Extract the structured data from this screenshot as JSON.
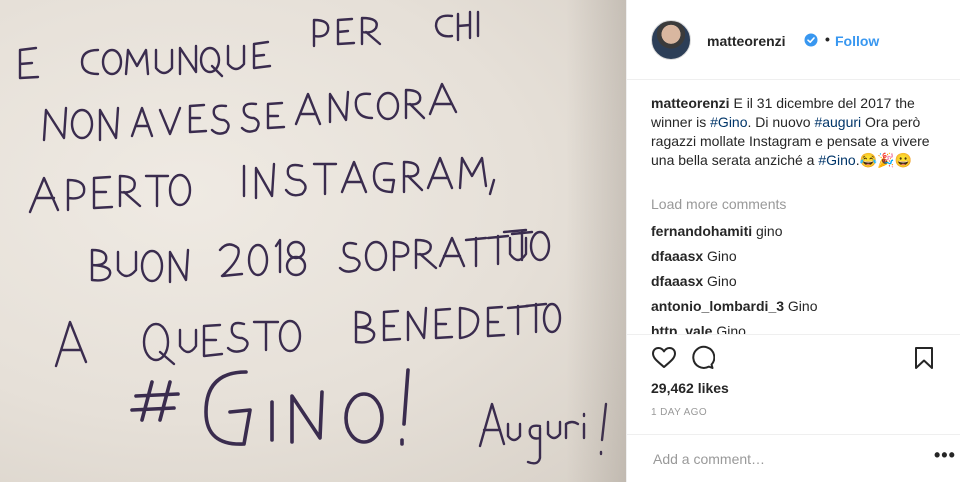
{
  "colors": {
    "link_blue": "#3897f0",
    "hashtag": "#003569",
    "muted": "#999999",
    "text": "#262626",
    "ink": "#3a2c4e"
  },
  "photo": {
    "handwriting_lines": [
      "E COMUNQUE PER CHI",
      "NON AVESSE ANCORA",
      "APERTO INSTAGRAM,",
      "BUON 2018 SOPRATTUTTO",
      "A QUESTO BENEDETTO",
      "#GINO!",
      "Auguri!"
    ]
  },
  "header": {
    "username": "matteorenzi",
    "separator": "•",
    "follow_label": "Follow",
    "verified_icon": "verified-badge-icon"
  },
  "caption": {
    "username": "matteorenzi",
    "text_1": "E il 31 dicembre del 2017 the winner is ",
    "tag_1": "#Gino",
    "text_2": ". Di nuovo ",
    "tag_2": "#auguri",
    "text_3": " Ora però ragazzi mollate Instagram e pensate a vivere una bella serata anziché a ",
    "tag_3": "#Gino",
    "text_4": ".😂🎉😀"
  },
  "load_more_label": "Load more comments",
  "comments": [
    {
      "user": "fernandohamiti",
      "text": "gino"
    },
    {
      "user": "dfaaasx",
      "text": "Gino"
    },
    {
      "user": "dfaaasx",
      "text": "Gino"
    },
    {
      "user": "antonio_lombardi_3",
      "text": "Gino"
    },
    {
      "user": "http_vale",
      "text": "Gino"
    }
  ],
  "actions": {
    "like_icon": "heart-icon",
    "comment_icon": "comment-icon",
    "save_icon": "bookmark-icon",
    "likes_count": "29,462 likes",
    "time_ago": "1 DAY AGO"
  },
  "add_comment": {
    "placeholder": "Add a comment…",
    "more_icon": "more-options-icon",
    "more_label": "•••"
  }
}
